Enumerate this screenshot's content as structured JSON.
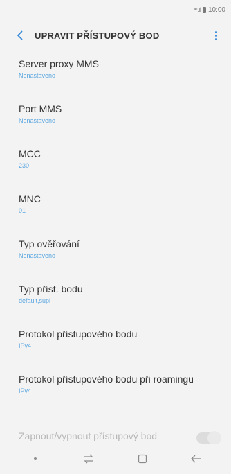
{
  "status_bar": {
    "signal": "ᵗᵗᵉ .ıl",
    "time": "10:00"
  },
  "header": {
    "title": "UPRAVIT PŘÍSTUPOVÝ BOD",
    "back_icon": "chevron-left-icon",
    "more_icon": "more-vertical-icon"
  },
  "items": [
    {
      "title": "Server proxy MMS",
      "value": "Nenastaveno"
    },
    {
      "title": "Port MMS",
      "value": "Nenastaveno"
    },
    {
      "title": "MCC",
      "value": "230"
    },
    {
      "title": "MNC",
      "value": "01"
    },
    {
      "title": "Typ ověřování",
      "value": "Nenastaveno"
    },
    {
      "title": "Typ příst. bodu",
      "value": "default,supl"
    },
    {
      "title": "Protokol přístupového bodu",
      "value": "IPv4"
    },
    {
      "title": "Protokol přístupového bodu při roamingu",
      "value": "IPv4"
    }
  ],
  "toggle": {
    "label": "Zapnout/vypnout přístupový bod"
  },
  "colors": {
    "accent": "#5aa6e0",
    "background": "#f3f3f3"
  }
}
